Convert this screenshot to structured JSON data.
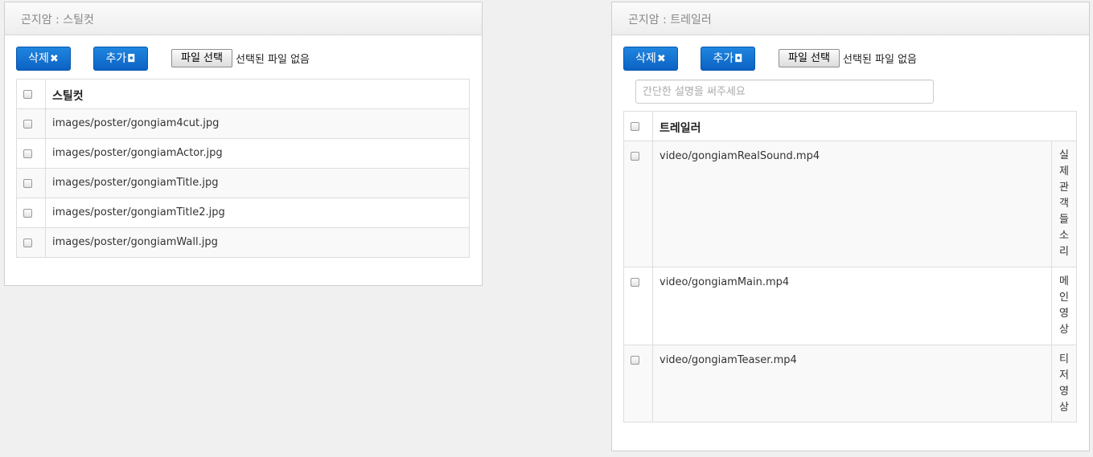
{
  "sticker_panel": {
    "title": "곤지암 : 스틸컷",
    "delete_label": "삭제",
    "add_label": "추가",
    "file_button": "파일 선택",
    "file_status": "선택된 파일 없음",
    "column_header": "스틸컷",
    "rows": [
      {
        "path": "images/poster/gongiam4cut.jpg"
      },
      {
        "path": "images/poster/gongiamActor.jpg"
      },
      {
        "path": "images/poster/gongiamTitle.jpg"
      },
      {
        "path": "images/poster/gongiamTitle2.jpg"
      },
      {
        "path": "images/poster/gongiamWall.jpg"
      }
    ]
  },
  "trailer_panel": {
    "title": "곤지암 : 트레일러",
    "delete_label": "삭제",
    "add_label": "추가",
    "file_button": "파일 선택",
    "file_status": "선택된 파일 없음",
    "description_placeholder": "간단한 설명을 써주세요",
    "column_header": "트레일러",
    "rows": [
      {
        "path": "video/gongiamRealSound.mp4",
        "description": "실제관객들소리"
      },
      {
        "path": "video/gongiamMain.mp4",
        "description": "메인영상"
      },
      {
        "path": "video/gongiamTeaser.mp4",
        "description": "티저영상"
      }
    ]
  },
  "icons": {
    "delete": "times-icon",
    "add": "inbox-icon"
  },
  "colors": {
    "primary_button": "#0c62c4",
    "background": "#f0f0f0"
  }
}
